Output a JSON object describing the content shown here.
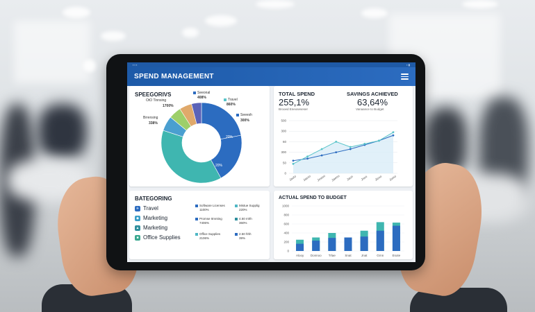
{
  "app": {
    "title": "SPEND MANAGEMENT"
  },
  "categories_card": {
    "title": "SPEEGORIVS",
    "labels": [
      {
        "name": "Seeonal",
        "value": "408%"
      },
      {
        "name": "Travel",
        "value": "860%"
      },
      {
        "name": "Seeesh",
        "value": "300%"
      },
      {
        "name": "OtO Tinnsing",
        "value": "1700%"
      },
      {
        "name": "Brrensing",
        "value": "338%"
      }
    ],
    "segment_labels": [
      "20%",
      "20%"
    ]
  },
  "totals_card": {
    "total_label": "TOTAL SPEND",
    "total_value": "255,1%",
    "total_sub": "Brooed Eneoseseser",
    "savings_label": "SAVINGS ACHIEVED",
    "savings_value": "63,64%",
    "savings_sub": "Vanaance to Budget",
    "y_ticks": [
      "500",
      "300",
      "60",
      "300",
      "50",
      "0"
    ]
  },
  "categoring_card": {
    "title": "BATEGORING",
    "items": [
      {
        "label": "Travel",
        "icon": "plane-icon",
        "color": "#2c6cc0"
      },
      {
        "label": "Marketing",
        "icon": "megaphone-icon",
        "color": "#3a9ec7"
      },
      {
        "label": "Marketing",
        "icon": "chart-icon",
        "color": "#2f8f9d"
      },
      {
        "label": "Office Supplies",
        "icon": "clipboard-icon",
        "color": "#3aa88f"
      }
    ],
    "details": [
      {
        "name": "Software Licenses",
        "value": "1100%",
        "color": "#2c6cc0"
      },
      {
        "name": "Mistue Supplig",
        "value": "220%",
        "color": "#4fb7c5"
      },
      {
        "name": "Promse Itmnting",
        "value": "7406%",
        "color": "#2c6cc0"
      },
      {
        "name": "4.50 mhh",
        "value": "360%",
        "color": "#2f8f9d"
      },
      {
        "name": "Office Supplies",
        "value": "2106%",
        "color": "#4fb7c5"
      },
      {
        "name": "2.50 hhh",
        "value": "39%",
        "color": "#2c6cc0"
      }
    ]
  },
  "budget_card": {
    "title": "ACTUAL SPEND TO BUDGET",
    "y_ticks": [
      "1000",
      "800",
      "600",
      "400",
      "200",
      "0"
    ]
  },
  "colors": {
    "brand": "#1d5aa8",
    "teal": "#3fb6b0",
    "blue": "#2c6cc0",
    "light_teal": "#58c4c9"
  },
  "chart_data": [
    {
      "type": "pie",
      "title": "SPEEGORIVS",
      "slices": [
        {
          "label": "Seeonal",
          "value": 22,
          "color": "#2c6cc0"
        },
        {
          "label": "Seeesh",
          "value": 20,
          "color": "#2c6cc0"
        },
        {
          "label": "Brrensing",
          "value": 38,
          "color": "#3fb6b0"
        },
        {
          "label": "OtO Tinnsing",
          "value": 6,
          "color": "#4a9fd0"
        },
        {
          "label": "Travel",
          "value": 5,
          "color": "#9dcf6a"
        },
        {
          "label": "other",
          "value": 5,
          "color": "#e0a96b"
        },
        {
          "label": "other2",
          "value": 4,
          "color": "#5b63b8"
        }
      ]
    },
    {
      "type": "line",
      "x": [
        "Jaoto",
        "Jasoo",
        "Jowoo",
        "Jawoo",
        "Jaon",
        "Jnoo",
        "Jlooo",
        "Jomo"
      ],
      "series": [
        {
          "values": [
            120,
            140,
            170,
            200,
            230,
            270,
            310,
            360
          ],
          "color": "#2c6cc0"
        },
        {
          "values": [
            90,
            160,
            230,
            300,
            250,
            280,
            310,
            390
          ],
          "color": "#58c4c9"
        }
      ],
      "ylim": [
        0,
        500
      ]
    },
    {
      "type": "bar",
      "title": "ACTUAL SPEND TO BUDGET",
      "categories": [
        "Alooy",
        "Donnoo",
        "Trlae",
        "Snat",
        "Jnat",
        "Grnn",
        "Esote"
      ],
      "series": [
        {
          "values": [
            160,
            230,
            290,
            300,
            320,
            450,
            560
          ],
          "color": "#2c6cc0"
        },
        {
          "values": [
            250,
            300,
            400,
            200,
            450,
            640,
            630
          ],
          "color": "#3fb6b0"
        }
      ],
      "ylim": [
        0,
        1000
      ]
    }
  ]
}
